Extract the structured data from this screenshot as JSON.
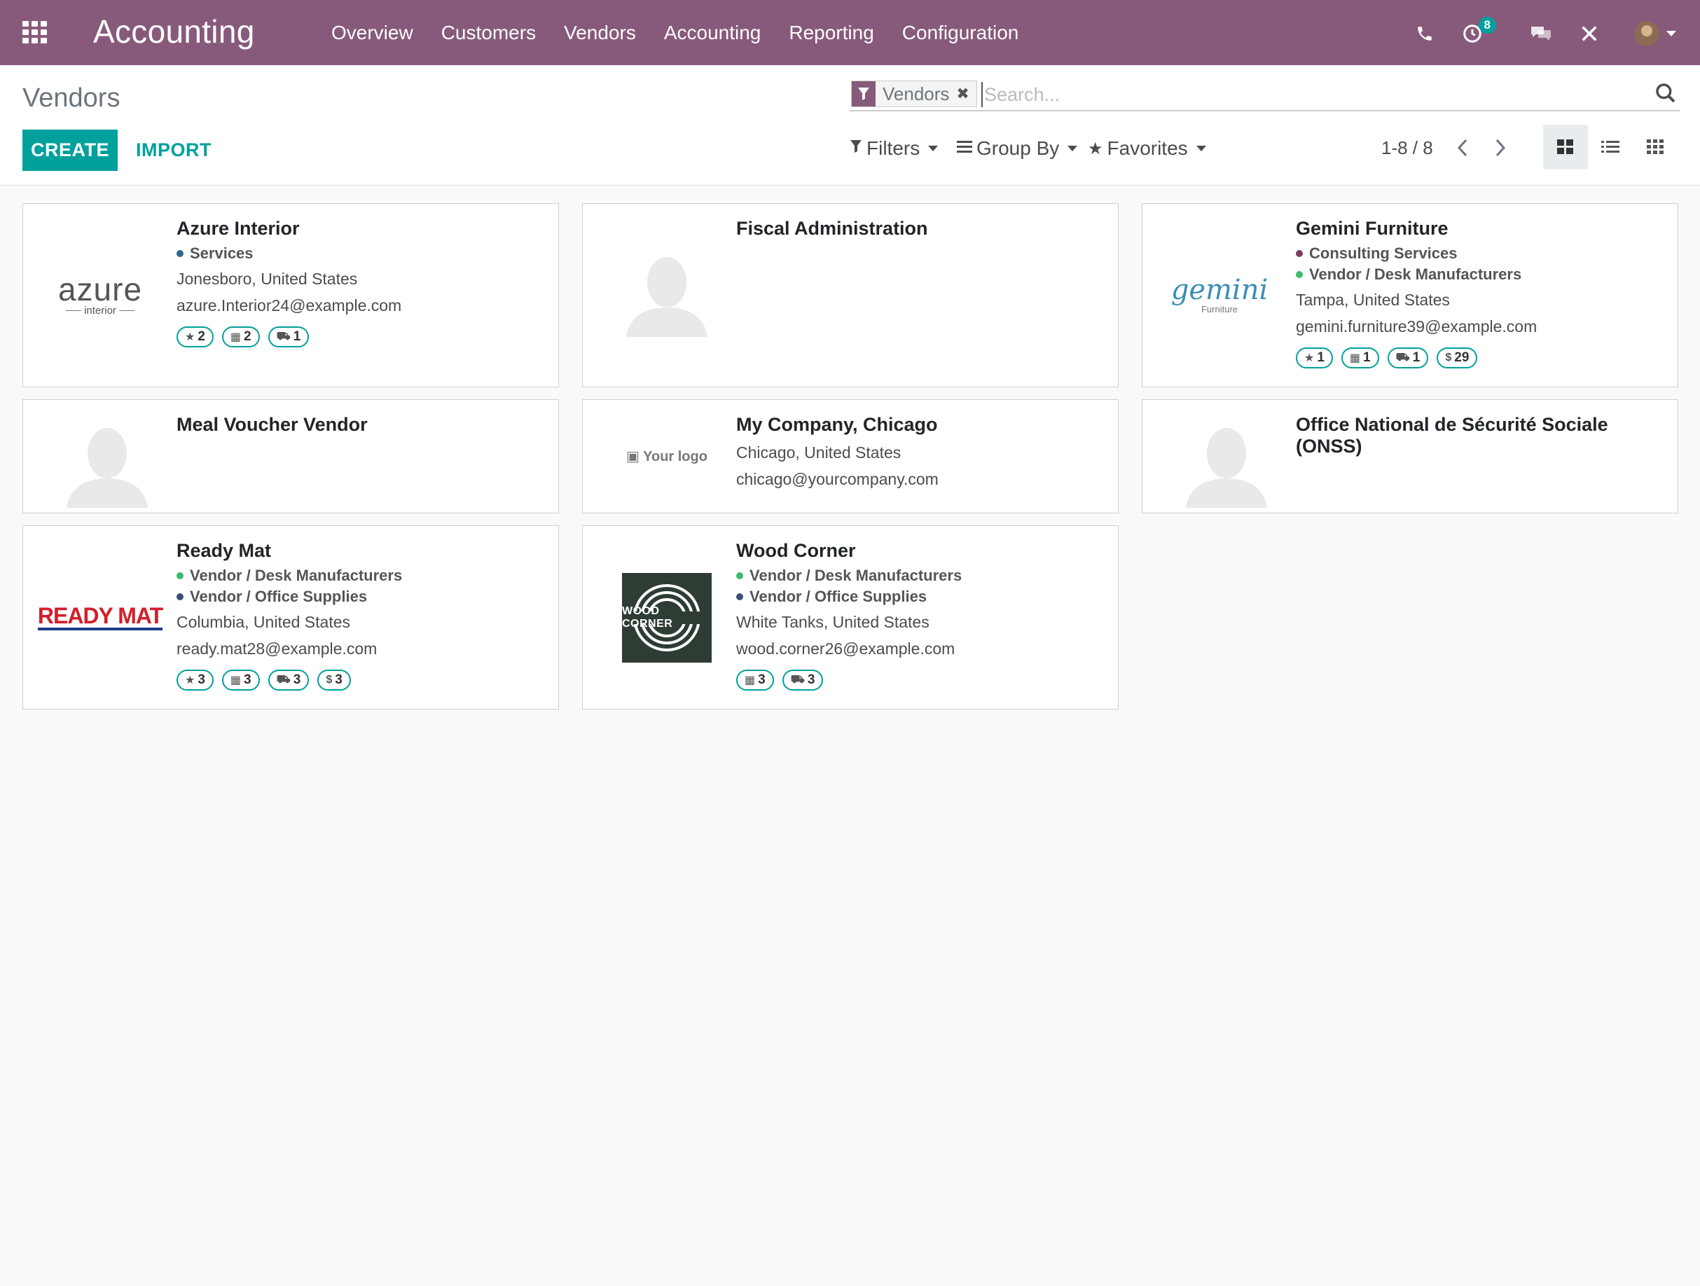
{
  "topbar": {
    "brand": "Accounting",
    "menu": [
      "Overview",
      "Customers",
      "Vendors",
      "Accounting",
      "Reporting",
      "Configuration"
    ],
    "activity_badge": "8",
    "brand_color": "#875a7b",
    "accent_color": "#00a09d"
  },
  "control": {
    "title": "Vendors",
    "create_label": "CREATE",
    "import_label": "IMPORT",
    "facet_label": "Vendors",
    "search_placeholder": "Search...",
    "filters_label": "Filters",
    "groupby_label": "Group By",
    "favorites_label": "Favorites",
    "pager": "1-8 / 8"
  },
  "cards": [
    {
      "name": "Azure Interior",
      "logo_text": "azure",
      "logo_sub": "interior",
      "tags": [
        {
          "label": "Services",
          "color": "#30678f"
        }
      ],
      "location": "Jonesboro, United States",
      "email": "azure.Interior24@example.com",
      "pills": [
        {
          "icon": "★",
          "count": "2"
        },
        {
          "icon": "▦",
          "count": "2"
        },
        {
          "icon": "⛟",
          "count": "1"
        }
      ]
    },
    {
      "name": "Fiscal Administration"
    },
    {
      "name": "Gemini Furniture",
      "logo_text": "gemini",
      "logo_sub": "Furniture",
      "tags": [
        {
          "label": "Consulting Services",
          "color": "#7a3e5c"
        },
        {
          "label": "Vendor / Desk Manufacturers",
          "color": "#3dbb6a"
        }
      ],
      "location": "Tampa, United States",
      "email": "gemini.furniture39@example.com",
      "pills": [
        {
          "icon": "★",
          "count": "1"
        },
        {
          "icon": "▦",
          "count": "1"
        },
        {
          "icon": "⛟",
          "count": "1"
        },
        {
          "icon": "$",
          "count": "29"
        }
      ]
    },
    {
      "name": "Meal Voucher Vendor"
    },
    {
      "name": "My Company, Chicago",
      "logo_text": "Your logo",
      "location": "Chicago, United States",
      "email": "chicago@yourcompany.com"
    },
    {
      "name": "Office National de Sécurité Sociale (ONSS)"
    },
    {
      "name": "Ready Mat",
      "logo_text": "READY MAT",
      "tags": [
        {
          "label": "Vendor / Desk Manufacturers",
          "color": "#3dbb6a"
        },
        {
          "label": "Vendor / Office Supplies",
          "color": "#3b4e73"
        }
      ],
      "location": "Columbia, United States",
      "email": "ready.mat28@example.com",
      "pills": [
        {
          "icon": "★",
          "count": "3"
        },
        {
          "icon": "▦",
          "count": "3"
        },
        {
          "icon": "⛟",
          "count": "3"
        },
        {
          "icon": "$",
          "count": "3"
        }
      ]
    },
    {
      "name": "Wood Corner",
      "logo_text": "WOOD CORNER",
      "tags": [
        {
          "label": "Vendor / Desk Manufacturers",
          "color": "#3dbb6a"
        },
        {
          "label": "Vendor / Office Supplies",
          "color": "#3b4e73"
        }
      ],
      "location": "White Tanks, United States",
      "email": "wood.corner26@example.com",
      "pills": [
        {
          "icon": "▦",
          "count": "3"
        },
        {
          "icon": "⛟",
          "count": "3"
        }
      ]
    }
  ]
}
